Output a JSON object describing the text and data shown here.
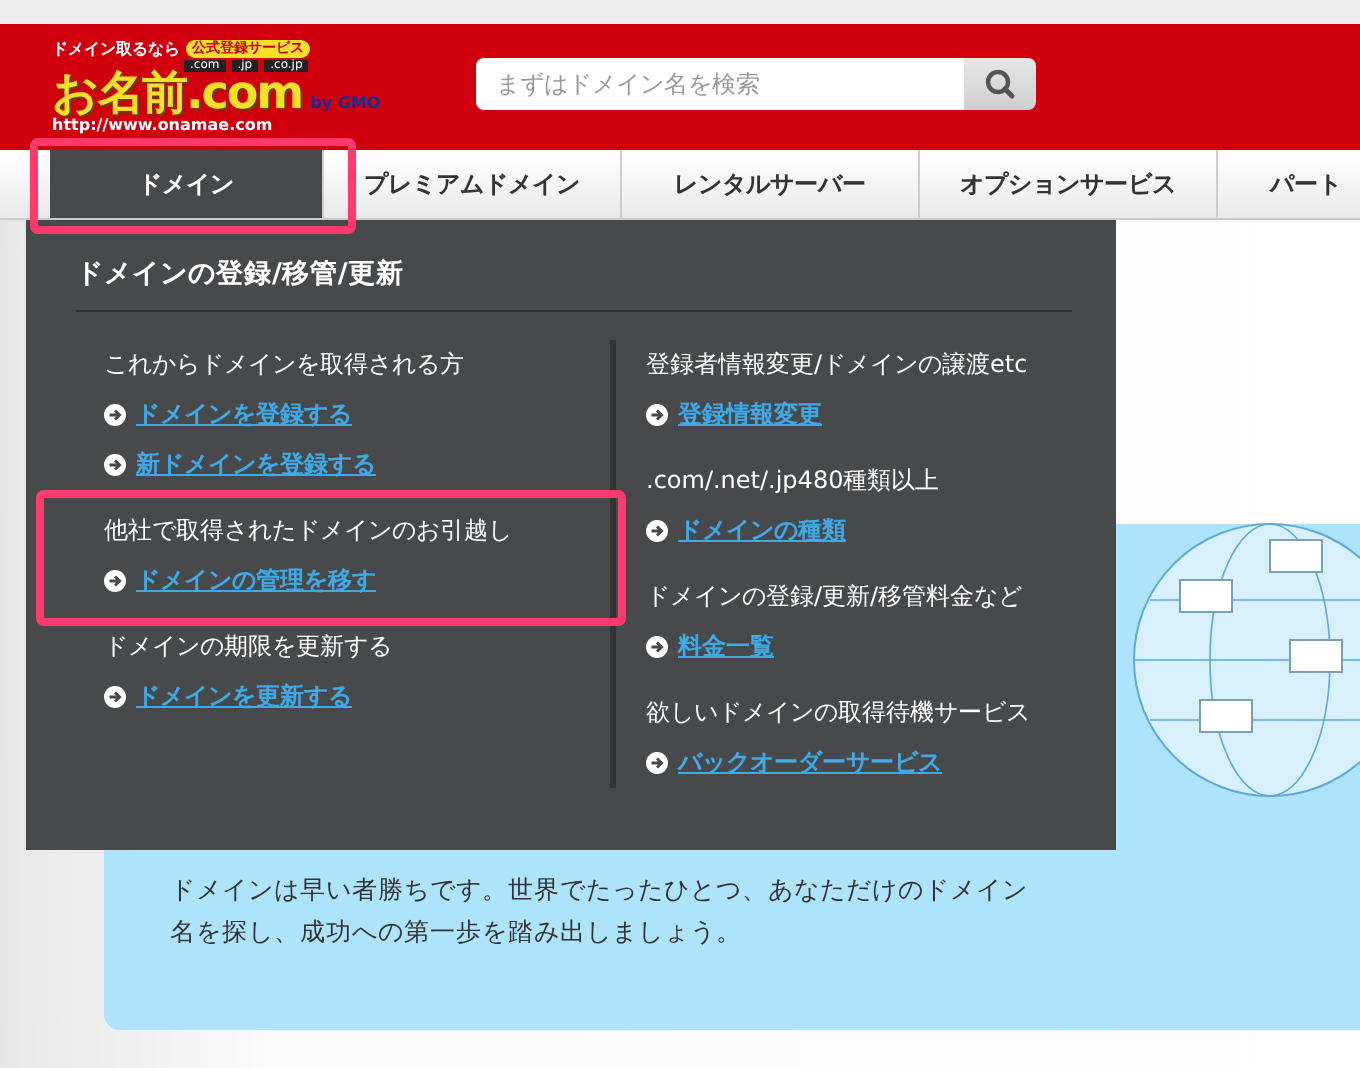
{
  "header": {
    "logo": {
      "tagline": "ドメイン取るなら",
      "badge": "公式登録サービス",
      "tlds": [
        ".com",
        ".jp",
        ".co.jp"
      ],
      "name": "お名前.com",
      "by": "by GMO",
      "url": "http://www.onamae.com"
    },
    "search": {
      "placeholder": "まずはドメイン名を検索"
    }
  },
  "nav": {
    "tabs": [
      {
        "label": "ドメイン",
        "selected": true,
        "highlighted": true
      },
      {
        "label": "プレミアムドメイン",
        "selected": false,
        "highlighted": false
      },
      {
        "label": "レンタルサーバー",
        "selected": false,
        "highlighted": false
      },
      {
        "label": "オプションサービス",
        "selected": false,
        "highlighted": false
      },
      {
        "label": "パート",
        "selected": false,
        "highlighted": false
      }
    ]
  },
  "dropdown": {
    "title": "ドメインの登録/移管/更新",
    "columns": [
      {
        "groups": [
          {
            "heading": "これからドメインを取得される方",
            "highlighted": false,
            "links": [
              "ドメインを登録する",
              "新ドメインを登録する"
            ]
          },
          {
            "heading": "他社で取得されたドメインのお引越し",
            "highlighted": true,
            "links": [
              "ドメインの管理を移す"
            ]
          },
          {
            "heading": "ドメインの期限を更新する",
            "highlighted": false,
            "links": [
              "ドメインを更新する"
            ]
          }
        ]
      },
      {
        "groups": [
          {
            "heading": "登録者情報変更/ドメインの譲渡etc",
            "highlighted": false,
            "links": [
              "登録情報変更"
            ]
          },
          {
            "heading": ".com/.net/.jp480種類以上",
            "highlighted": false,
            "links": [
              "ドメインの種類"
            ]
          },
          {
            "heading": "ドメインの登録/更新/移管料金など",
            "highlighted": false,
            "links": [
              "料金一覧"
            ]
          },
          {
            "heading": "欲しいドメインの取得待機サービス",
            "highlighted": false,
            "links": [
              "バックオーダーサービス"
            ]
          }
        ]
      }
    ]
  },
  "banner": {
    "lines": [
      "ドメインは早い者勝ちです。世界でたったひとつ、あなただけのドメイン",
      "名を探し、成功への第一歩を踏み出しましょう。"
    ]
  }
}
